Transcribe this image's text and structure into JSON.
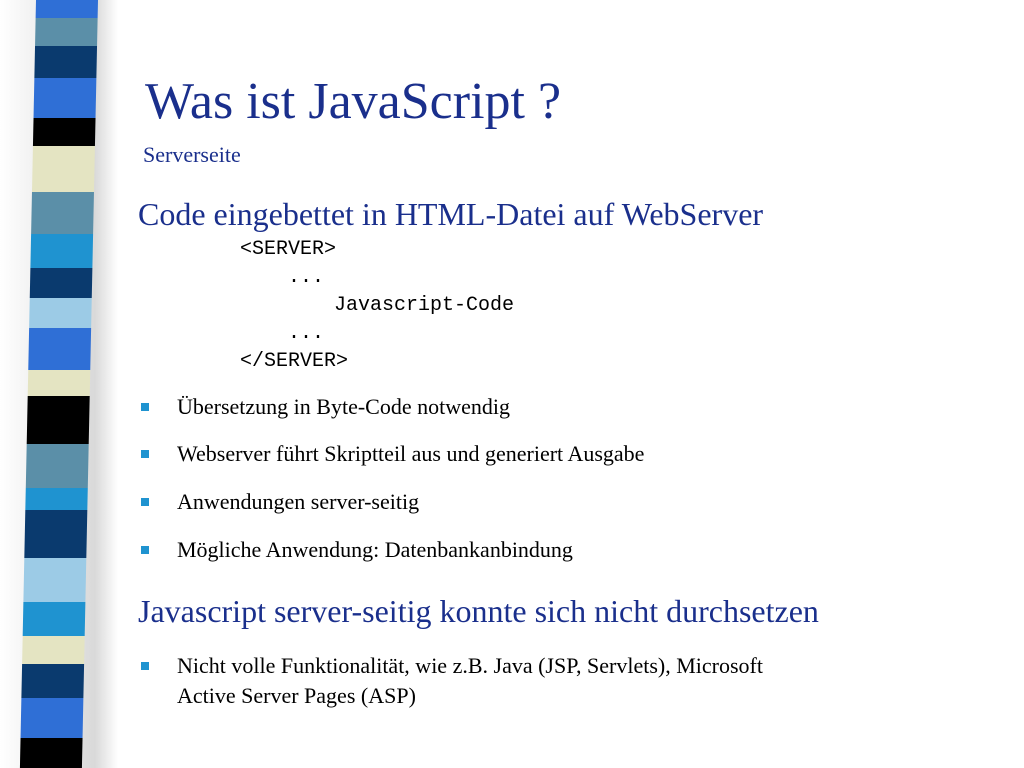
{
  "slide": {
    "title": "Was ist JavaScript ?",
    "subtitle": "Serverseite",
    "heading1": "Code eingebettet in HTML-Datei auf  WebServer",
    "code_lines": [
      "<SERVER>",
      "...",
      "Javascript-Code",
      "...",
      "</SERVER>"
    ],
    "bullets1": [
      "Übersetzung in Byte-Code notwendig",
      "Webserver führt Skriptteil aus und generiert Ausgabe",
      "Anwendungen server-seitig",
      "Mögliche Anwendung: Datenbankanbindung"
    ],
    "heading2": "Javascript server-seitig konnte sich nicht durchsetzen",
    "bullets2": [
      {
        "line1": "Nicht volle Funktionalität, wie z.B. Java (JSP, Servlets), Microsoft",
        "line2": "Active Server Pages (ASP)"
      }
    ]
  },
  "colors": {
    "title": "#1a2f8c",
    "bullet_mark": "#1f93d0",
    "ribbon": [
      "#5b8fa8",
      "#1f93d0",
      "#0a3a6e",
      "#2f6fd6",
      "#000000",
      "#e4e4c2",
      "#9ccbe6"
    ]
  }
}
